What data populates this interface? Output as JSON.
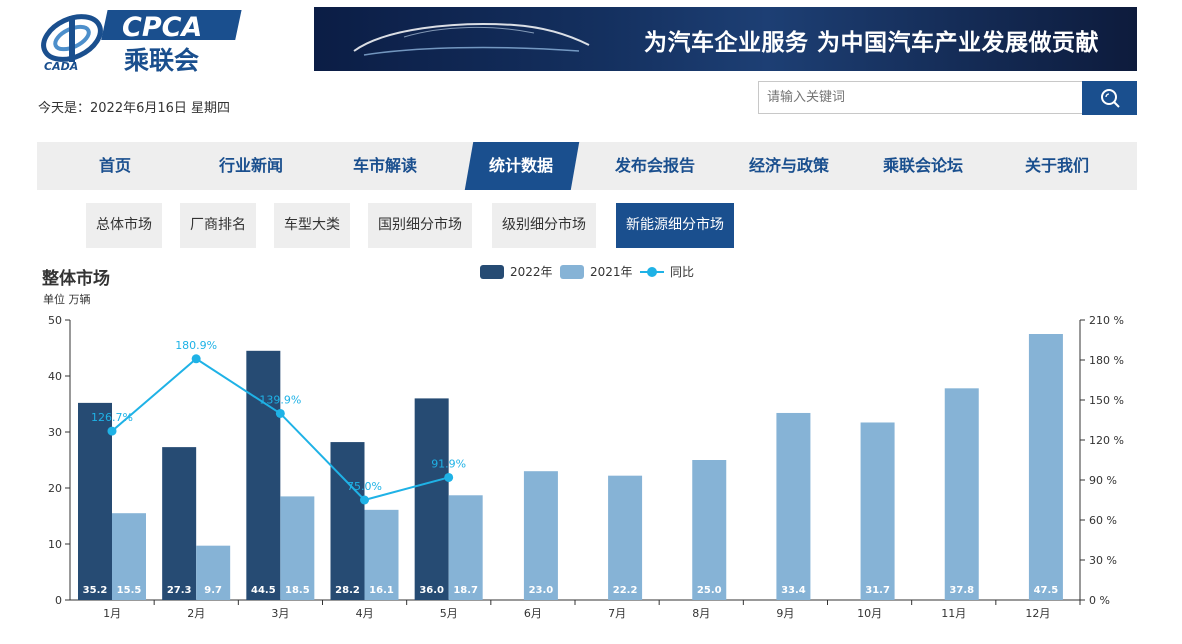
{
  "header": {
    "logo_text": "CPCA",
    "logo_cn": "乘联会",
    "logo_sub": "CADA",
    "banner_text": "为汽车企业服务 为中国汽车产业发展做贡献",
    "date_line": "今天是：2022年6月16日 星期四",
    "search_placeholder": "请输入关键词",
    "search_icon": "search-icon"
  },
  "nav": {
    "items": [
      "首页",
      "行业新闻",
      "车市解读",
      "统计数据",
      "发布会报告",
      "经济与政策",
      "乘联会论坛",
      "关于我们"
    ],
    "active": "统计数据"
  },
  "sub_tabs": {
    "items": [
      "总体市场",
      "厂商排名",
      "车型大类",
      "国别细分市场",
      "级别细分市场",
      "新能源细分市场"
    ],
    "active": "新能源细分市场"
  },
  "colors": {
    "accent": "#1a4f8e",
    "bar_2022": "#264b73",
    "bar_2021": "#86b3d6",
    "line": "#1fb2e6"
  },
  "chart_data": {
    "type": "bar",
    "title": "整体市场",
    "unit": "单位 万辆",
    "categories": [
      "1月",
      "2月",
      "3月",
      "4月",
      "5月",
      "6月",
      "7月",
      "8月",
      "9月",
      "10月",
      "11月",
      "12月"
    ],
    "series": [
      {
        "name": "2022年",
        "type": "bar",
        "values": [
          35.2,
          27.3,
          44.5,
          28.2,
          36.0,
          null,
          null,
          null,
          null,
          null,
          null,
          null
        ]
      },
      {
        "name": "2021年",
        "type": "bar",
        "values": [
          15.5,
          9.7,
          18.5,
          16.1,
          18.7,
          23.0,
          22.2,
          25.0,
          33.4,
          31.7,
          37.8,
          47.5
        ]
      },
      {
        "name": "同比",
        "type": "line",
        "axis": "right",
        "values": [
          126.7,
          180.9,
          139.9,
          75.0,
          91.9,
          null,
          null,
          null,
          null,
          null,
          null,
          null
        ]
      }
    ],
    "y_left": {
      "min": 0,
      "max": 50,
      "ticks": [
        "0",
        "10",
        "20",
        "30",
        "40",
        "50"
      ]
    },
    "y_right": {
      "min": 0,
      "max": 210,
      "ticks": [
        "0 %",
        "30 %",
        "60 %",
        "90 %",
        "120 %",
        "150 %",
        "180 %",
        "210 %"
      ]
    },
    "legend_position": "top-center"
  }
}
